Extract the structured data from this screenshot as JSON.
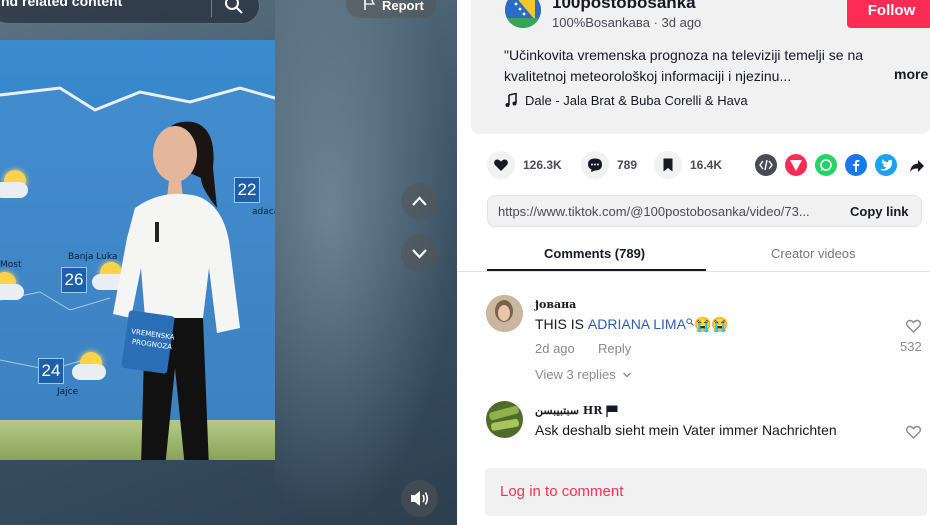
{
  "search": {
    "text": "nd related content",
    "icon": "search-icon"
  },
  "report": {
    "label": "Report",
    "icon": "flag-icon"
  },
  "video": {
    "cities": [
      "Most",
      "Banja Luka",
      "Jajce",
      "adacac"
    ],
    "temperatures": [
      "26",
      "24",
      "22"
    ],
    "card_line1": "VREMENSKA",
    "card_line2": "PROGNOZA"
  },
  "nav": {
    "up_icon": "chevron-up-icon",
    "down_icon": "chevron-down-icon",
    "volume_icon": "volume-icon"
  },
  "author": {
    "username": "100postobosanka",
    "subline": "100%Bosankaвa · 3d ago",
    "follow_label": "Follow"
  },
  "post": {
    "description": "\"Učinkovita vremenska prognoza na televiziji temelji se na kvalitetnoj meteorološkoj informaciji i njezinu...",
    "more_label": "more",
    "music": "Dale - Jala Brat & Buba Corelli & Hava"
  },
  "stats": {
    "likes": "126.3K",
    "comments": "789",
    "saves": "16.4K"
  },
  "share_icons": [
    "embed-icon",
    "send-icon",
    "whatsapp-icon",
    "facebook-icon",
    "twitter-icon",
    "share-arrow-icon"
  ],
  "colors": {
    "accent": "#fe2c55",
    "mention": "#2b5db8",
    "whatsapp": "#25d366",
    "facebook": "#1877f2",
    "twitter": "#1da1f2"
  },
  "link": {
    "url": "https://www.tiktok.com/@100postobosanka/video/73...",
    "copy_label": "Copy link"
  },
  "tabs": {
    "comments": "Comments (789)",
    "creator": "Creator videos"
  },
  "comments": [
    {
      "name": "јована",
      "text_prefix": "THIS IS ",
      "mention": "ADRIANA LIMA",
      "emoji": "😭😭",
      "date": "2d ago",
      "reply_label": "Reply",
      "view_replies": "View 3 replies",
      "likes": "532"
    },
    {
      "name": "سبتبيبسن HR",
      "text": "Ask deshalb sieht mein Vater immer Nachrichten"
    }
  ],
  "login": {
    "label": "Log in to comment"
  }
}
